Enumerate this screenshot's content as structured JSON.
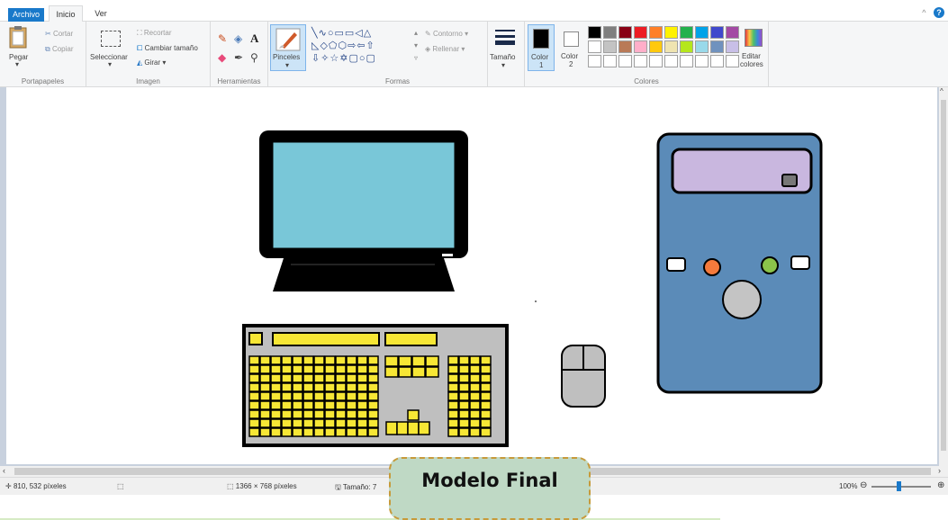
{
  "tabs": {
    "file": "Archivo",
    "home": "Inicio",
    "view": "Ver"
  },
  "clipboard": {
    "paste": "Pegar",
    "cut": "Cortar",
    "copy": "Copiar",
    "group": "Portapapeles"
  },
  "image": {
    "select": "Seleccionar",
    "crop": "Recortar",
    "resize": "Cambiar tamaño",
    "rotate": "Girar",
    "group": "Imagen"
  },
  "tools": {
    "group": "Herramientas"
  },
  "brushes": {
    "label": "Pinceles"
  },
  "shapes": {
    "outline": "Contorno",
    "fill": "Rellenar",
    "group": "Formas"
  },
  "size": {
    "label": "Tamaño"
  },
  "colors": {
    "color1": "Color\n1",
    "color1_a": "Color",
    "color1_b": "1",
    "color2_a": "Color",
    "color2_b": "2",
    "edit_a": "Editar",
    "edit_b": "colores",
    "group": "Colores",
    "palette_row1": [
      "#000000",
      "#7f7f7f",
      "#880015",
      "#ed1c24",
      "#ff7f27",
      "#fff200",
      "#22b14c",
      "#00a2e8",
      "#3f48cc",
      "#a349a4"
    ],
    "palette_row2": [
      "#ffffff",
      "#c3c3c3",
      "#b97a57",
      "#ffaec9",
      "#ffc90e",
      "#efe4b0",
      "#b5e61d",
      "#99d9ea",
      "#7092be",
      "#c8bfe7"
    ]
  },
  "status": {
    "cursor": "810, 532 píxeles",
    "dimensions": "1366 × 768 píxeles",
    "filesize": "Tamaño: 7",
    "zoom": "100%"
  },
  "banner": {
    "text": "Modelo Final"
  },
  "canvas_colors": {
    "monitor_screen": "#79c7d8",
    "keyboard_body": "#bfbfbf",
    "keys": "#f7e735",
    "tower": "#5b8bb8",
    "drive": "#c9b7df",
    "orange_button": "#f47a3c",
    "green_button": "#8bc34a"
  }
}
